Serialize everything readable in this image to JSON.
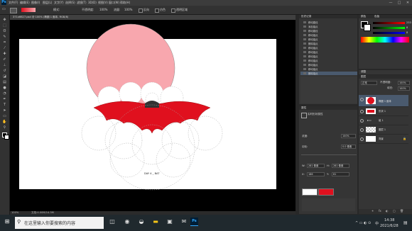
{
  "app": {
    "logo": "Ps"
  },
  "menu": {
    "items": [
      "文件(F)",
      "编辑(E)",
      "图像(I)",
      "图层(L)",
      "文字(Y)",
      "选择(S)",
      "滤镜(T)",
      "3D(D)",
      "视图(V)",
      "窗口(W)",
      "帮助(H)"
    ]
  },
  "window_controls": {
    "minimize": "—",
    "maximize": "□",
    "close": "✕"
  },
  "options_bar": {
    "mode_label": "模式:",
    "opacity_label": "不透明度:",
    "opacity_value": "100%",
    "flow_label": "流量:",
    "flow_value": "100%",
    "reverse_label": "反向",
    "dither_label": "仿色",
    "transparency_label": "透明区域",
    "swatch_color": "#e0101e"
  },
  "document": {
    "tab_title": "371x6627.psd @ 100% (椭圆 1 副本, RGB/8)",
    "caption": "DAY 4 _ BAT",
    "zoom": "100%",
    "doc_size": "文档:4.00M/14.3M"
  },
  "history": {
    "title": "历史记录",
    "items": [
      {
        "label": "移动路径"
      },
      {
        "label": "添加锚点"
      },
      {
        "label": "移动路径"
      },
      {
        "label": "移动锚点"
      },
      {
        "label": "移动锚点"
      },
      {
        "label": "删除锚点"
      },
      {
        "label": "移动锚点"
      },
      {
        "label": "移动锚点"
      },
      {
        "label": "移动锚点"
      },
      {
        "label": "移动锚点"
      },
      {
        "label": "移动锚点"
      },
      {
        "label": "移动锚点"
      },
      {
        "label": "删除锚点",
        "active": true
      }
    ]
  },
  "color_panel": {
    "tab": "颜色",
    "swatches_tab": "色板",
    "r": "233",
    "g": "8",
    "b": "8"
  },
  "adjustments": {
    "tab": "调整"
  },
  "properties": {
    "tab": "属性",
    "kind": "实时形状属性",
    "w_label": "W:",
    "w": "281 像素",
    "h_label": "H:",
    "h": "281 像素",
    "x_label": "X:",
    "x": "186",
    "y_label": "Y:",
    "y": "61",
    "feather_label": "羽化:",
    "feather": "0.0 像素",
    "density_label": "浓度:",
    "density": "100%",
    "fill_color": "#e0101e"
  },
  "layers": {
    "tab": "图层",
    "blend": "正常",
    "opacity_label": "不透明度:",
    "opacity": "100%",
    "fill_label": "填充:",
    "fill": "100%",
    "rows": [
      {
        "name": "椭圆 1 副本"
      },
      {
        "name": "形状 1"
      },
      {
        "name": "组 1"
      },
      {
        "name": "图层 1"
      },
      {
        "name": "背景"
      }
    ]
  },
  "taskbar": {
    "search_placeholder": "在这里输入你要搜索的内容",
    "time": "14:38",
    "date": "2021/6/28",
    "ime": "中"
  },
  "colors": {
    "pink": "#f8a7ae",
    "red": "#e0101e",
    "ps_bg": "#323232"
  }
}
